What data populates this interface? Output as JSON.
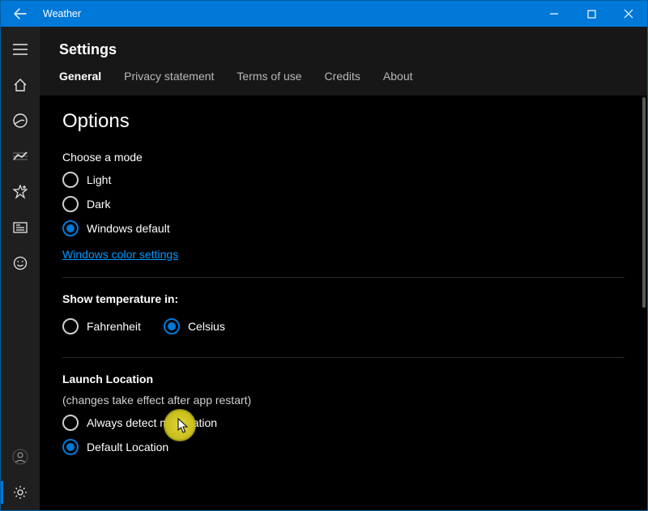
{
  "titlebar": {
    "title": "Weather"
  },
  "sidebar": {
    "items": [
      {
        "name": "menu",
        "icon": "menu"
      },
      {
        "name": "home",
        "icon": "home"
      },
      {
        "name": "radar",
        "icon": "radar"
      },
      {
        "name": "trends",
        "icon": "chart"
      },
      {
        "name": "favorites",
        "icon": "star"
      },
      {
        "name": "news",
        "icon": "news"
      },
      {
        "name": "feedback",
        "icon": "smile"
      }
    ],
    "bottom": [
      {
        "name": "account",
        "icon": "account"
      },
      {
        "name": "settings",
        "icon": "gear",
        "active": true
      }
    ]
  },
  "header": {
    "title": "Settings",
    "tabs": [
      {
        "label": "General",
        "active": true
      },
      {
        "label": "Privacy statement"
      },
      {
        "label": "Terms of use"
      },
      {
        "label": "Credits"
      },
      {
        "label": "About"
      }
    ]
  },
  "options": {
    "heading": "Options",
    "mode": {
      "label": "Choose a mode",
      "choices": [
        {
          "label": "Light",
          "checked": false
        },
        {
          "label": "Dark",
          "checked": false
        },
        {
          "label": "Windows default",
          "checked": true
        }
      ],
      "link": "Windows color settings"
    },
    "temperature": {
      "label": "Show temperature in:",
      "choices": [
        {
          "label": "Fahrenheit",
          "checked": false
        },
        {
          "label": "Celsius",
          "checked": true
        }
      ]
    },
    "launch": {
      "label": "Launch Location",
      "note": "(changes take effect after app restart)",
      "choices": [
        {
          "label": "Always detect my location",
          "checked": false
        },
        {
          "label": "Default Location",
          "checked": true
        }
      ]
    }
  }
}
